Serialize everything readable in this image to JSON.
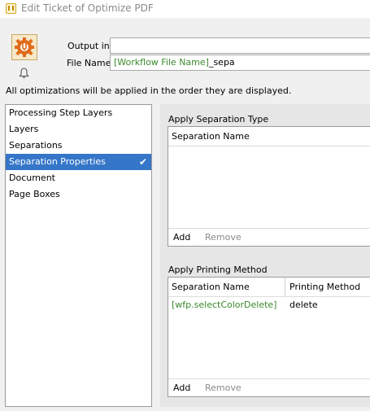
{
  "window": {
    "title": "Edit Ticket of Optimize PDF"
  },
  "header": {
    "icon": "gear-tool-icon",
    "output_label": "Output in:",
    "output_value": "",
    "filename_label": "File Name:",
    "filename_var": "[Workflow File Name]",
    "filename_suffix": "_sepa",
    "note": "All optimizations will be applied in the order they are displayed."
  },
  "sidebar": {
    "items": [
      {
        "label": "Processing Step Layers",
        "selected": false
      },
      {
        "label": "Layers",
        "selected": false
      },
      {
        "label": "Separations",
        "selected": false
      },
      {
        "label": "Separation Properties",
        "selected": true
      },
      {
        "label": "Document",
        "selected": false
      },
      {
        "label": "Page Boxes",
        "selected": false
      }
    ],
    "check_glyph": "✔"
  },
  "separation_type": {
    "title": "Apply Separation Type",
    "columns": [
      "Separation Name"
    ],
    "rows": [],
    "add_label": "Add",
    "remove_label": "Remove"
  },
  "printing_method": {
    "title": "Apply Printing Method",
    "columns": [
      "Separation Name",
      "Printing Method"
    ],
    "rows": [
      {
        "separation": "[wfp.selectColorDelete]",
        "method": "delete"
      }
    ],
    "add_label": "Add",
    "remove_label": "Remove"
  },
  "colors": {
    "selection": "#3576c8",
    "variable_text": "#3a8a2b",
    "disabled_text": "#8a8a8a"
  }
}
